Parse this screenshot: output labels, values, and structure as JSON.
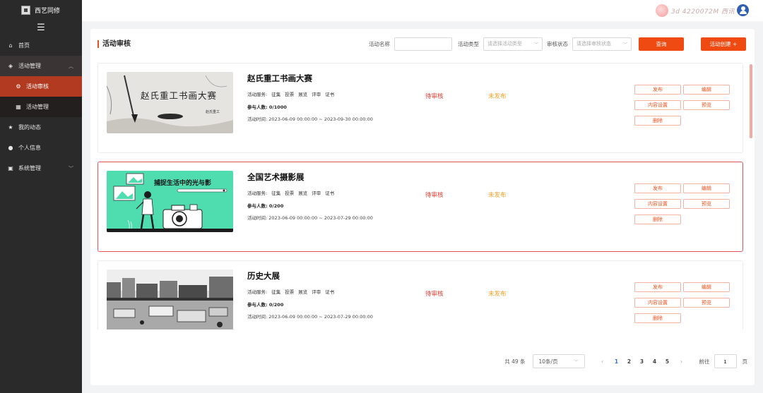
{
  "sidebar": {
    "brand": "西艺同修",
    "items": [
      {
        "label": "首页",
        "icon": "home-icon"
      },
      {
        "label": "活动管理",
        "icon": "cube-icon"
      },
      {
        "label": "活动审核",
        "icon": "gear-icon"
      },
      {
        "label": "活动管理",
        "icon": "grid-icon"
      },
      {
        "label": "我的动态",
        "icon": "star-icon"
      },
      {
        "label": "个人信息",
        "icon": "user-icon"
      },
      {
        "label": "系统管理",
        "icon": "settings-box-icon"
      }
    ]
  },
  "topbar": {
    "watermark_text": "3d 4220072M 西讯"
  },
  "page": {
    "title": "活动审核"
  },
  "filters": {
    "name_label": "活动名称",
    "name_value": "",
    "type_label": "活动类型",
    "type_placeholder": "请选择活动类型",
    "status_label": "审核状态",
    "status_placeholder": "请选择审核状态",
    "query_button": "查询",
    "create_button": "活动创建 +"
  },
  "labels": {
    "services": "活动服务:",
    "participants_prefix": "参与人数:",
    "time_prefix": "活动时间:"
  },
  "actions": {
    "publish": "发布",
    "edit": "编辑",
    "content_settings": "内容设置",
    "preview": "预览",
    "delete": "删除"
  },
  "activities": [
    {
      "title": "赵氏重工书画大赛",
      "services": [
        "征集",
        "投票",
        "展览",
        "评审",
        "证书"
      ],
      "participants": "0/1000",
      "time": "2023-06-09 00:00:00 ~ 2023-09-30 00:00:00",
      "review_status": "待审核",
      "publish_status": "未发布",
      "image_text": "赵氏重工书画大赛",
      "image_subtext": "赵氏重工",
      "selected": false
    },
    {
      "title": "全国艺术摄影展",
      "services": [
        "征集",
        "投票",
        "展览",
        "评审",
        "证书"
      ],
      "participants": "0/200",
      "time": "2023-06-09 00:00:00 ~ 2023-07-29 00:00:00",
      "review_status": "待审核",
      "publish_status": "未发布",
      "image_text": "捕捉生活中的光与影",
      "selected": true
    },
    {
      "title": "历史大展",
      "services": [
        "征集",
        "投票",
        "展览",
        "评审",
        "证书"
      ],
      "participants": "0/200",
      "time": "2023-06-09 00:00:00 ~ 2023-07-29 00:00:00",
      "review_status": "待审核",
      "publish_status": "未发布",
      "selected": false
    }
  ],
  "pagination": {
    "total": "共 49 条",
    "page_size": "10条/页",
    "pages": [
      "1",
      "2",
      "3",
      "4",
      "5"
    ],
    "current": "1",
    "goto_label": "前往",
    "goto_value": "1",
    "page_suffix": "页"
  },
  "colors": {
    "accent": "#f04a13",
    "sidebar_bg": "#2b2a2a",
    "active_menu": "#b23a20",
    "review_status": "#e23a2e",
    "publish_status": "#f0a020",
    "page_current": "#2f73d9"
  }
}
